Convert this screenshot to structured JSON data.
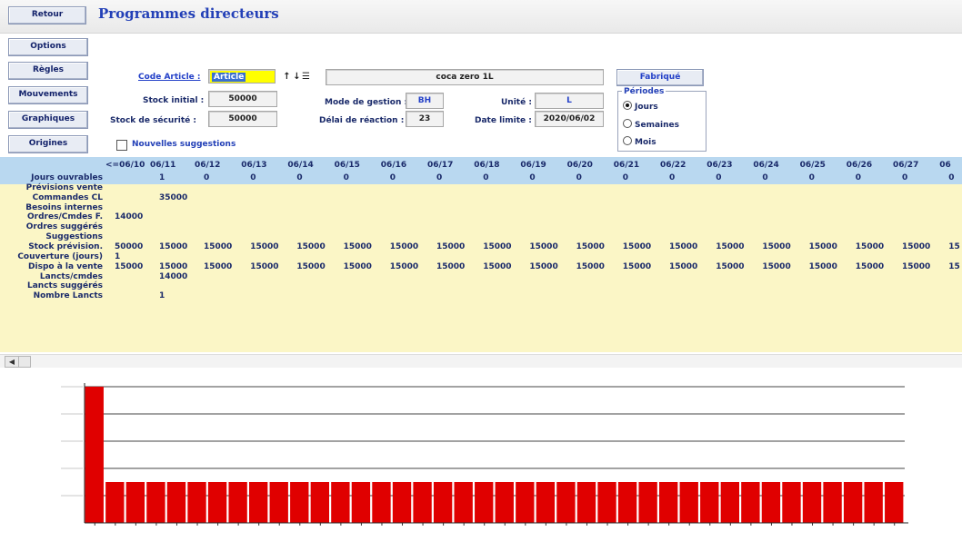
{
  "header": {
    "back_label": "Retour",
    "title": "Programmes directeurs"
  },
  "sidebar": {
    "items": [
      "Options",
      "Règles",
      "Mouvements",
      "Graphiques",
      "Origines"
    ]
  },
  "form": {
    "code_article_label": "Code Article :",
    "code_article_value": "Article",
    "description": "coca zero 1L",
    "fabrique_label": "Fabriqué",
    "stock_initial_label": "Stock initial :",
    "stock_initial_value": "50000",
    "stock_securite_label": "Stock de sécurité :",
    "stock_securite_value": "50000",
    "mode_gestion_label": "Mode de gestion :",
    "mode_gestion_value": "BH",
    "delai_label": "Délai de réaction :",
    "delai_value": "23",
    "unite_label": "Unité :",
    "unite_value": "L",
    "date_limite_label": "Date limite :",
    "date_limite_value": "2020/06/02",
    "nouvelles_label": "Nouvelles suggestions"
  },
  "periodes": {
    "title": "Périodes",
    "options": [
      "Jours",
      "Semaines",
      "Mois"
    ],
    "selected": 0
  },
  "grid": {
    "columns": [
      "<=06/10",
      "06/11",
      "06/12",
      "06/13",
      "06/14",
      "06/15",
      "06/16",
      "06/17",
      "06/18",
      "06/19",
      "06/20",
      "06/21",
      "06/22",
      "06/23",
      "06/24",
      "06/25",
      "06/26",
      "06/27",
      "06"
    ],
    "rows": [
      {
        "label": "Jours ouvrables",
        "values": [
          "",
          "1",
          "0",
          "0",
          "0",
          "0",
          "0",
          "0",
          "0",
          "0",
          "0",
          "0",
          "0",
          "0",
          "0",
          "0",
          "0",
          "0",
          "0"
        ]
      },
      {
        "label": "Prévisions vente",
        "values": []
      },
      {
        "label": "Commandes CL",
        "values": [
          "",
          "35000"
        ]
      },
      {
        "label": "Besoins internes",
        "values": []
      },
      {
        "label": "Ordres/Cmdes F.",
        "values": [
          "14000"
        ]
      },
      {
        "label": "Ordres suggérés",
        "values": []
      },
      {
        "label": "Suggestions",
        "values": []
      },
      {
        "label": "Stock prévision.",
        "values": [
          "50000",
          "15000",
          "15000",
          "15000",
          "15000",
          "15000",
          "15000",
          "15000",
          "15000",
          "15000",
          "15000",
          "15000",
          "15000",
          "15000",
          "15000",
          "15000",
          "15000",
          "15000",
          "15"
        ]
      },
      {
        "label": "Couverture (jours)",
        "values": [
          "1"
        ]
      },
      {
        "label": "Dispo à la vente",
        "values": [
          "15000",
          "15000",
          "15000",
          "15000",
          "15000",
          "15000",
          "15000",
          "15000",
          "15000",
          "15000",
          "15000",
          "15000",
          "15000",
          "15000",
          "15000",
          "15000",
          "15000",
          "15000",
          "15"
        ]
      },
      {
        "label": "Lancts/cmdes",
        "values": [
          "",
          "14000"
        ]
      },
      {
        "label": "Lancts suggérés",
        "values": []
      },
      {
        "label": "Nombre Lancts",
        "values": [
          "",
          "1"
        ]
      }
    ]
  },
  "chart_data": {
    "type": "bar",
    "values": [
      50000,
      15000,
      15000,
      15000,
      15000,
      15000,
      15000,
      15000,
      15000,
      15000,
      15000,
      15000,
      15000,
      15000,
      15000,
      15000,
      15000,
      15000,
      15000,
      15000,
      15000,
      15000,
      15000,
      15000,
      15000,
      15000,
      15000,
      15000,
      15000,
      15000,
      15000,
      15000,
      15000,
      15000,
      15000,
      15000,
      15000,
      15000,
      15000,
      15000
    ],
    "ylim": [
      0,
      50000
    ],
    "yticks": [
      10000,
      20000,
      30000,
      40000,
      50000
    ],
    "bar_color": "#e00000",
    "grid": true
  },
  "colors": {
    "header_row": "#b9d8f0",
    "grid_bg": "#fbf6c6",
    "code_field": "#ffff00",
    "bar": "#e00000",
    "title": "#2340b7"
  }
}
